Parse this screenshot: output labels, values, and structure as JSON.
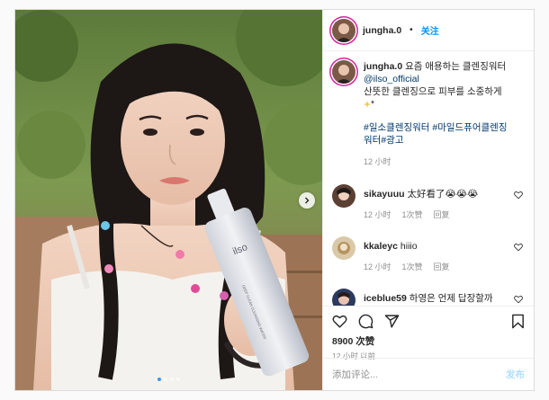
{
  "header": {
    "username": "jungha.0",
    "separator": "•",
    "follow_label": "关注"
  },
  "caption": {
    "username": "jungha.0",
    "line1": "요즘 애용하는 클렌징워터",
    "mention": "@ilso_official",
    "line2": "산뜻한 클렌징으로 피부를 소중하게",
    "hashtags_line1": "#일소클렌징워터 #마일드퓨어클렌징",
    "hashtags_line2": "워터#광고",
    "time": "12 小时"
  },
  "comments": [
    {
      "username": "sikayuuu",
      "text": "太好看了😭😭😭",
      "time": "12 小时",
      "likes": "1次赞",
      "reply": "回复"
    },
    {
      "username": "kkaleyc",
      "text": "hiiio",
      "time": "12 小时",
      "likes": "1次赞",
      "reply": "回复"
    },
    {
      "username": "iceblue59",
      "text": "하영은 언제 답장할까",
      "time": "",
      "likes": "",
      "reply": ""
    }
  ],
  "actions": {
    "likes": "8900 次赞",
    "time": "12 小时 以前"
  },
  "add_comment": {
    "placeholder": "添加评论...",
    "post_label": "发布"
  },
  "photo": {
    "bottle_brand": "ilso",
    "bottle_text": "DEEP CLEAN CLEANSING WATER",
    "carousel_count": 4,
    "carousel_active": 1
  },
  "colors": {
    "link": "#00376b",
    "follow": "#0095f6",
    "meta": "#8e8e8e",
    "post_disabled": "#b2dffc"
  },
  "icons": [
    "heart-icon",
    "comment-icon",
    "share-icon",
    "bookmark-icon",
    "chevron-right-icon"
  ]
}
